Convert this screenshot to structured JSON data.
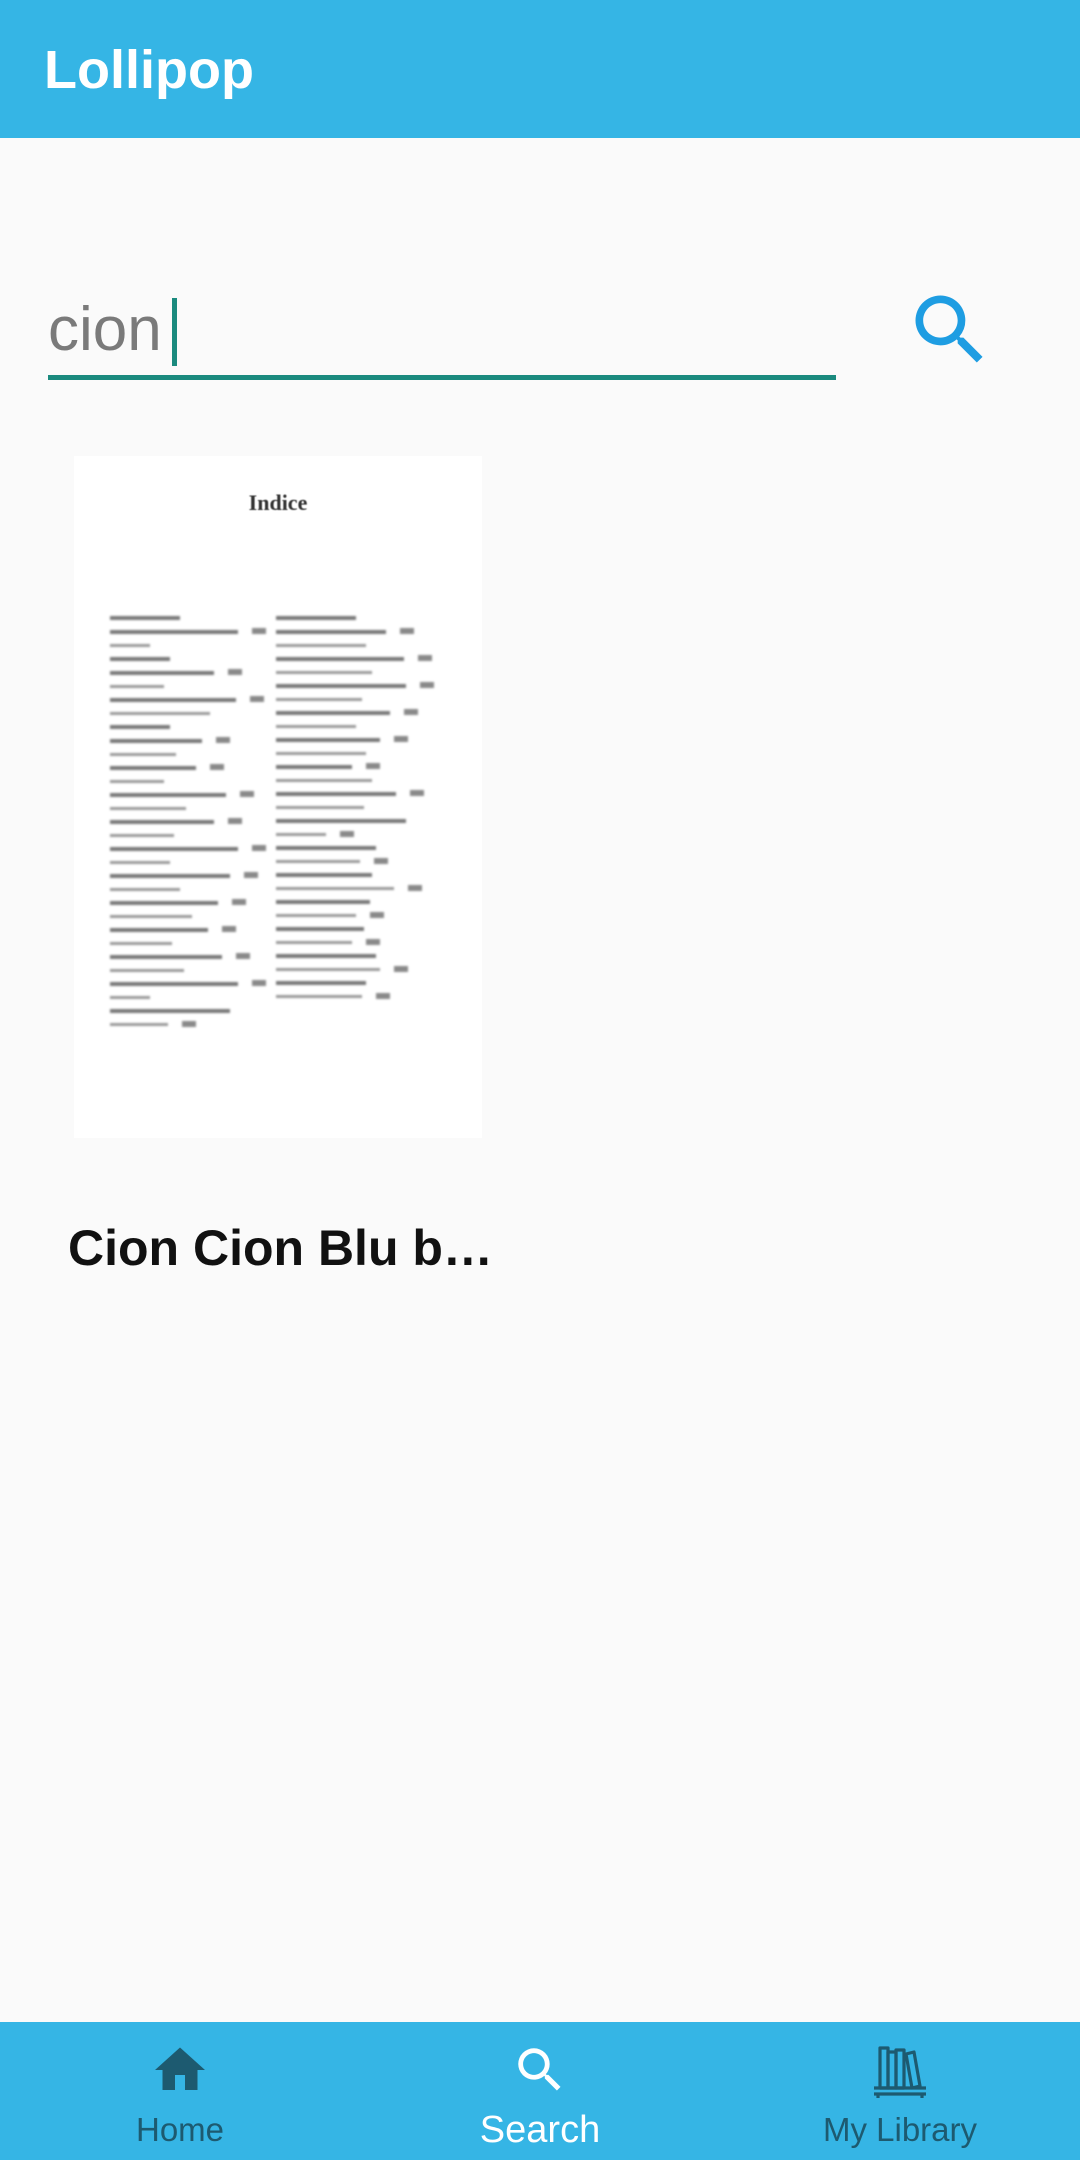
{
  "app": {
    "title": "Lollipop",
    "accent_color": "#35b5e5",
    "input_underline_color": "#1a8a7e",
    "search_icon_color": "#1e9de2"
  },
  "search": {
    "value": "cion",
    "button_icon": "search-icon"
  },
  "results": [
    {
      "title": "Cion Cion Blu b…",
      "cover_heading": "Indice"
    }
  ],
  "bottom_nav": {
    "items": [
      {
        "label": "Home",
        "icon": "home-icon",
        "active": false
      },
      {
        "label": "Search",
        "icon": "search-icon",
        "active": true
      },
      {
        "label": "My Library",
        "icon": "library-shelf-icon",
        "active": false
      }
    ]
  }
}
